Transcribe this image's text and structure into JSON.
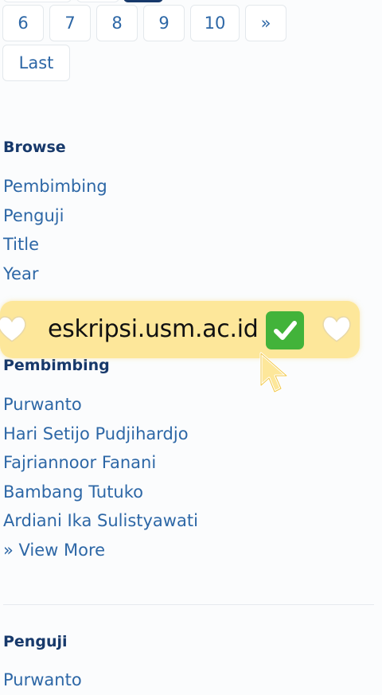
{
  "pagination": {
    "pages": [
      "6",
      "7",
      "8",
      "9",
      "10",
      "»"
    ],
    "last_label": "Last"
  },
  "browse": {
    "title": "Browse",
    "items": [
      "Pembimbing",
      "Penguji",
      "Title",
      "Year"
    ]
  },
  "banner": {
    "text": "eskripsi.usm.ac.id"
  },
  "pembimbing": {
    "title": "Pembimbing",
    "items": [
      "Purwanto",
      "Hari Setijo Pudjihardjo",
      "Fajriannoor Fanani",
      "Bambang Tutuko",
      "Ardiani Ika Sulistyawati"
    ],
    "view_more": "» View More"
  },
  "penguji": {
    "title": "Penguji",
    "items": [
      "Purwanto"
    ]
  },
  "colors": {
    "link": "#2d67a6",
    "heading": "#17396b",
    "banner_bg": "#fde79a",
    "check_green": "#42b33a"
  }
}
